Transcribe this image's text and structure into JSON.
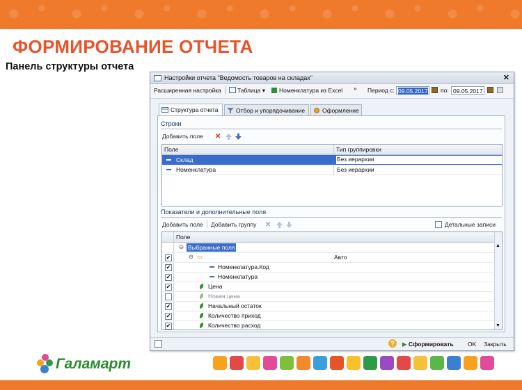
{
  "slide": {
    "title": "ФОРМИРОВАНИЕ ОТЧЕТА",
    "subtitle": "Панель структуры отчета",
    "accent_color": "#f07a2c",
    "title_color": "#e8532a",
    "logo_text": "Галамарт"
  },
  "window": {
    "title": "Настройки отчета \"Ведомость товаров на складах\"",
    "close_icon": "close-icon",
    "toolbar": {
      "advanced": "Расширенная настройка",
      "table": "Таблица",
      "nomenclature_excel": "Номенклатура из Excel",
      "more": "»",
      "period_label": "Период с:",
      "date_from": "09.05.2017",
      "to_label": "по:",
      "date_to": "09.05.2017"
    },
    "tabs": [
      {
        "label": "Структура отчета"
      },
      {
        "label": "Отбор и упорядочивание"
      },
      {
        "label": "Оформление"
      }
    ],
    "rows_section": {
      "title": "Строки",
      "add_field": "Добавить поле",
      "col_field": "Поле",
      "col_grouping": "Тип группировки",
      "rows": [
        {
          "field": "Склад",
          "grouping": "Без иерархии"
        },
        {
          "field": "Номенклатура",
          "grouping": "Без иерархии"
        }
      ]
    },
    "indicators_section": {
      "title": "Показатели и дополнительные поля",
      "add_field": "Добавить поле",
      "add_group": "Добавить группу",
      "detail_records": "Детальные записи",
      "col_field": "Поле",
      "selected_fields": "Выбранные поля",
      "auto": "Авто",
      "items": [
        {
          "label": "Номенклатура.Код",
          "checked": true
        },
        {
          "label": "Номенклатура",
          "checked": true
        },
        {
          "label": "Цена",
          "checked": true
        },
        {
          "label": "Новая цена",
          "checked": false
        },
        {
          "label": "Начальный остаток",
          "checked": true
        },
        {
          "label": "Количество приход",
          "checked": true
        },
        {
          "label": "Количество расход",
          "checked": true
        }
      ]
    },
    "status": {
      "help": "?",
      "generate": "Сформировать",
      "ok": "OK",
      "close": "Закрыть"
    }
  }
}
